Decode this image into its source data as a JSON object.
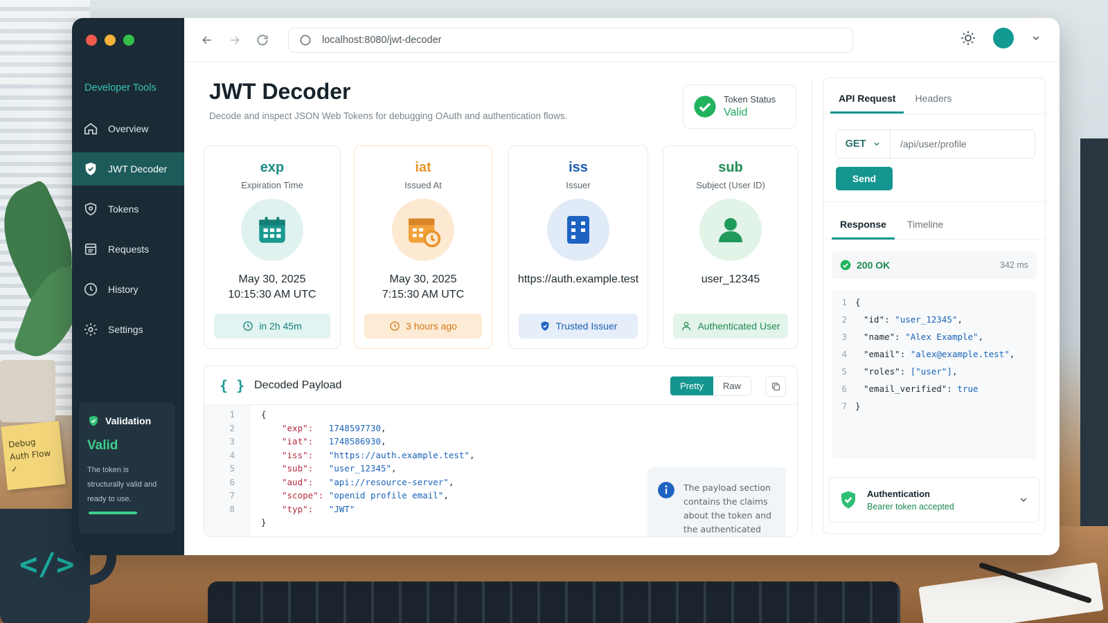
{
  "window": {
    "url": "localhost:8080/jwt-decoder"
  },
  "sidebar": {
    "brand": "Developer Tools",
    "items": [
      {
        "label": "Overview",
        "icon": "home-icon"
      },
      {
        "label": "JWT Decoder",
        "icon": "shield-icon"
      },
      {
        "label": "Tokens",
        "icon": "token-icon"
      },
      {
        "label": "Requests",
        "icon": "requests-icon"
      },
      {
        "label": "History",
        "icon": "clock-icon"
      },
      {
        "label": "Settings",
        "icon": "gear-icon"
      }
    ],
    "validation": {
      "title": "Validation",
      "status": "Valid",
      "text": "The token is structurally valid and ready to use."
    }
  },
  "page": {
    "title": "JWT Decoder",
    "subtitle": "Decode and inspect JSON Web Tokens for debugging OAuth and authentication flows.",
    "token_status_label": "Token Status",
    "token_status_value": "Valid"
  },
  "claims": [
    {
      "key": "exp",
      "label": "Expiration Time",
      "value_line1": "May 30, 2025",
      "value_line2": "10:15:30 AM UTC",
      "pill": "in 2h 45m",
      "icon": "calendar-icon"
    },
    {
      "key": "iat",
      "label": "Issued At",
      "value_line1": "May 30, 2025",
      "value_line2": "7:15:30 AM UTC",
      "pill": "3 hours ago",
      "icon": "calendar-clock-icon"
    },
    {
      "key": "iss",
      "label": "Issuer",
      "value_line1": "https://auth.example.test",
      "value_line2": "",
      "pill": "Trusted Issuer",
      "icon": "building-icon"
    },
    {
      "key": "sub",
      "label": "Subject (User ID)",
      "value_line1": "user_12345",
      "value_line2": "",
      "pill": "Authenticated User",
      "icon": "user-icon"
    }
  ],
  "payload": {
    "title": "Decoded Payload",
    "mode_pretty": "Pretty",
    "mode_raw": "Raw",
    "info": "The payload section contains the claims about the token and the authenticated entity.",
    "lines": [
      {
        "n": "1",
        "open": "{"
      },
      {
        "n": "2",
        "key": "\"exp\":",
        "pad": "   ",
        "val": "1748597730",
        "end": ","
      },
      {
        "n": "3",
        "key": "\"iat\":",
        "pad": "   ",
        "val": "1748586930",
        "end": ","
      },
      {
        "n": "4",
        "key": "\"iss\":",
        "pad": "   ",
        "val": "\"https://auth.example.test\"",
        "end": ","
      },
      {
        "n": "5",
        "key": "\"sub\":",
        "pad": "   ",
        "val": "\"user_12345\"",
        "end": ","
      },
      {
        "n": "6",
        "key": "\"aud\":",
        "pad": "   ",
        "val": "\"api://resource-server\"",
        "end": ","
      },
      {
        "n": "7",
        "key": "\"scope\":",
        "pad": " ",
        "val": "\"openid profile email\"",
        "end": ","
      },
      {
        "n": "8",
        "key": "\"typ\":",
        "pad": "   ",
        "val": "\"JWT\"",
        "end": ""
      },
      {
        "n": "",
        "open": "}"
      }
    ]
  },
  "api": {
    "tab_request": "API Request",
    "tab_headers": "Headers",
    "method": "GET",
    "path": "/api/user/profile",
    "send": "Send",
    "tab_response": "Response",
    "tab_timeline": "Timeline",
    "status": "200 OK",
    "time": "342 ms",
    "response_lines": [
      {
        "n": "1",
        "text": "{"
      },
      {
        "n": "2",
        "key": "\"id\"",
        "val": "\"user_12345\"",
        "end": ","
      },
      {
        "n": "3",
        "key": "\"name\"",
        "val": "\"Alex Example\"",
        "end": ","
      },
      {
        "n": "4",
        "key": "\"email\"",
        "val": "\"alex@example.test\"",
        "end": ","
      },
      {
        "n": "5",
        "key": "\"roles\"",
        "val": "[\"user\"]",
        "end": ","
      },
      {
        "n": "6",
        "key": "\"email_verified\"",
        "val": "true",
        "end": ""
      },
      {
        "n": "7",
        "text": "}"
      }
    ],
    "auth_title": "Authentication",
    "auth_sub": "Bearer token accepted"
  },
  "desk": {
    "sticky_note": "Debug\nAuth Flow\n✓",
    "mug_print": "</>"
  },
  "colors": {
    "accent": "#14958f",
    "success": "#1fa85e",
    "sidebar": "#1b2b35"
  }
}
